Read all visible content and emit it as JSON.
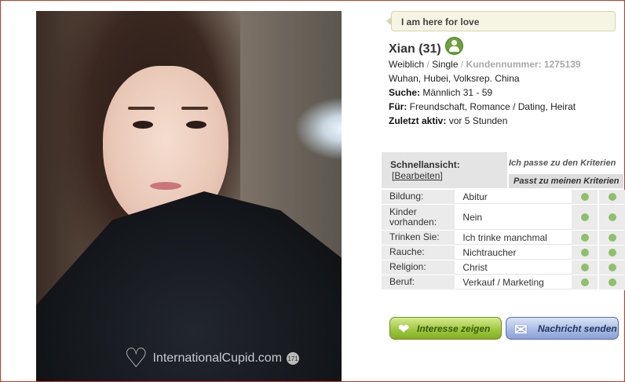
{
  "photo": {
    "watermark": "InternationalCupid.com",
    "photo_count": "171"
  },
  "status_bubble": "I am here for love",
  "profile": {
    "name": "Xian (31)",
    "gender": "Weiblich",
    "sep1": " / ",
    "status": "Single",
    "sep2": " / ",
    "member_label": "Kundennummer: 1275139",
    "location": "Wuhan, Hubei, Volksrep. China",
    "seeking_label": "Suche:",
    "seeking_value": "Männlich 31 - 59",
    "for_label": "Für:",
    "for_value": "Freundschaft, Romance / Dating, Heirat",
    "active_label": "Zuletzt aktiv:",
    "active_value": "vor 5 Stunden"
  },
  "quick": {
    "title": "Schnellansicht:",
    "edit": "[Bearbeiten]",
    "crit1": "Ich passe zu den Kriterien",
    "crit2": "Passt zu meinen Kriterien",
    "rows": [
      {
        "key": "Bildung:",
        "value": "Abitur"
      },
      {
        "key": "Kinder vorhanden:",
        "value": "Nein"
      },
      {
        "key": "Trinken Sie:",
        "value": "Ich trinke manchmal"
      },
      {
        "key": "Rauche:",
        "value": "Nichtraucher"
      },
      {
        "key": "Religion:",
        "value": "Christ"
      },
      {
        "key": "Beruf:",
        "value": "Verkauf / Marketing"
      }
    ],
    "match_color": "#8ec06c"
  },
  "buttons": {
    "interest": "Interesse zeigen",
    "message": "Nachricht senden"
  }
}
